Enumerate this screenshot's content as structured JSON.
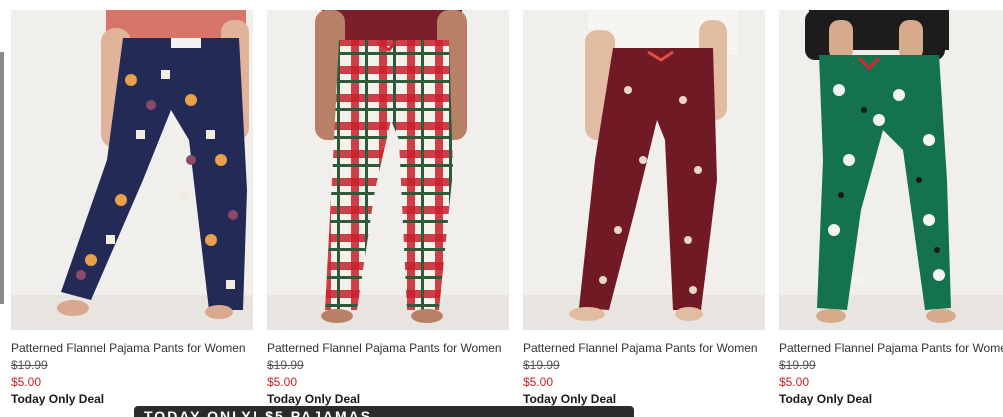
{
  "colors": {
    "sale_price": "#cc1f1f",
    "banner_bg": "#2b2b2b"
  },
  "products": [
    {
      "image_icon": "navy-patterned-pajama-pants-photo",
      "name": "Patterned Flannel Pajama Pants for Women",
      "original_price": "$19.99",
      "sale_price": "$5.00",
      "deal_label": "Today Only Deal"
    },
    {
      "image_icon": "red-plaid-pajama-pants-photo",
      "name": "Patterned Flannel Pajama Pants for Women",
      "original_price": "$19.99",
      "sale_price": "$5.00",
      "deal_label": "Today Only Deal"
    },
    {
      "image_icon": "burgundy-ski-pajama-pants-photo",
      "name": "Patterned Flannel Pajama Pants for Women",
      "original_price": "$19.99",
      "sale_price": "$5.00",
      "deal_label": "Today Only Deal"
    },
    {
      "image_icon": "green-sheep-pajama-pants-photo",
      "name": "Patterned Flannel Pajama Pants for Women",
      "original_price": "$19.99",
      "sale_price": "$5.00",
      "deal_label": "Today Only Deal"
    }
  ],
  "banner": {
    "text": "TODAY ONLY! $5 PAJAMAS"
  }
}
